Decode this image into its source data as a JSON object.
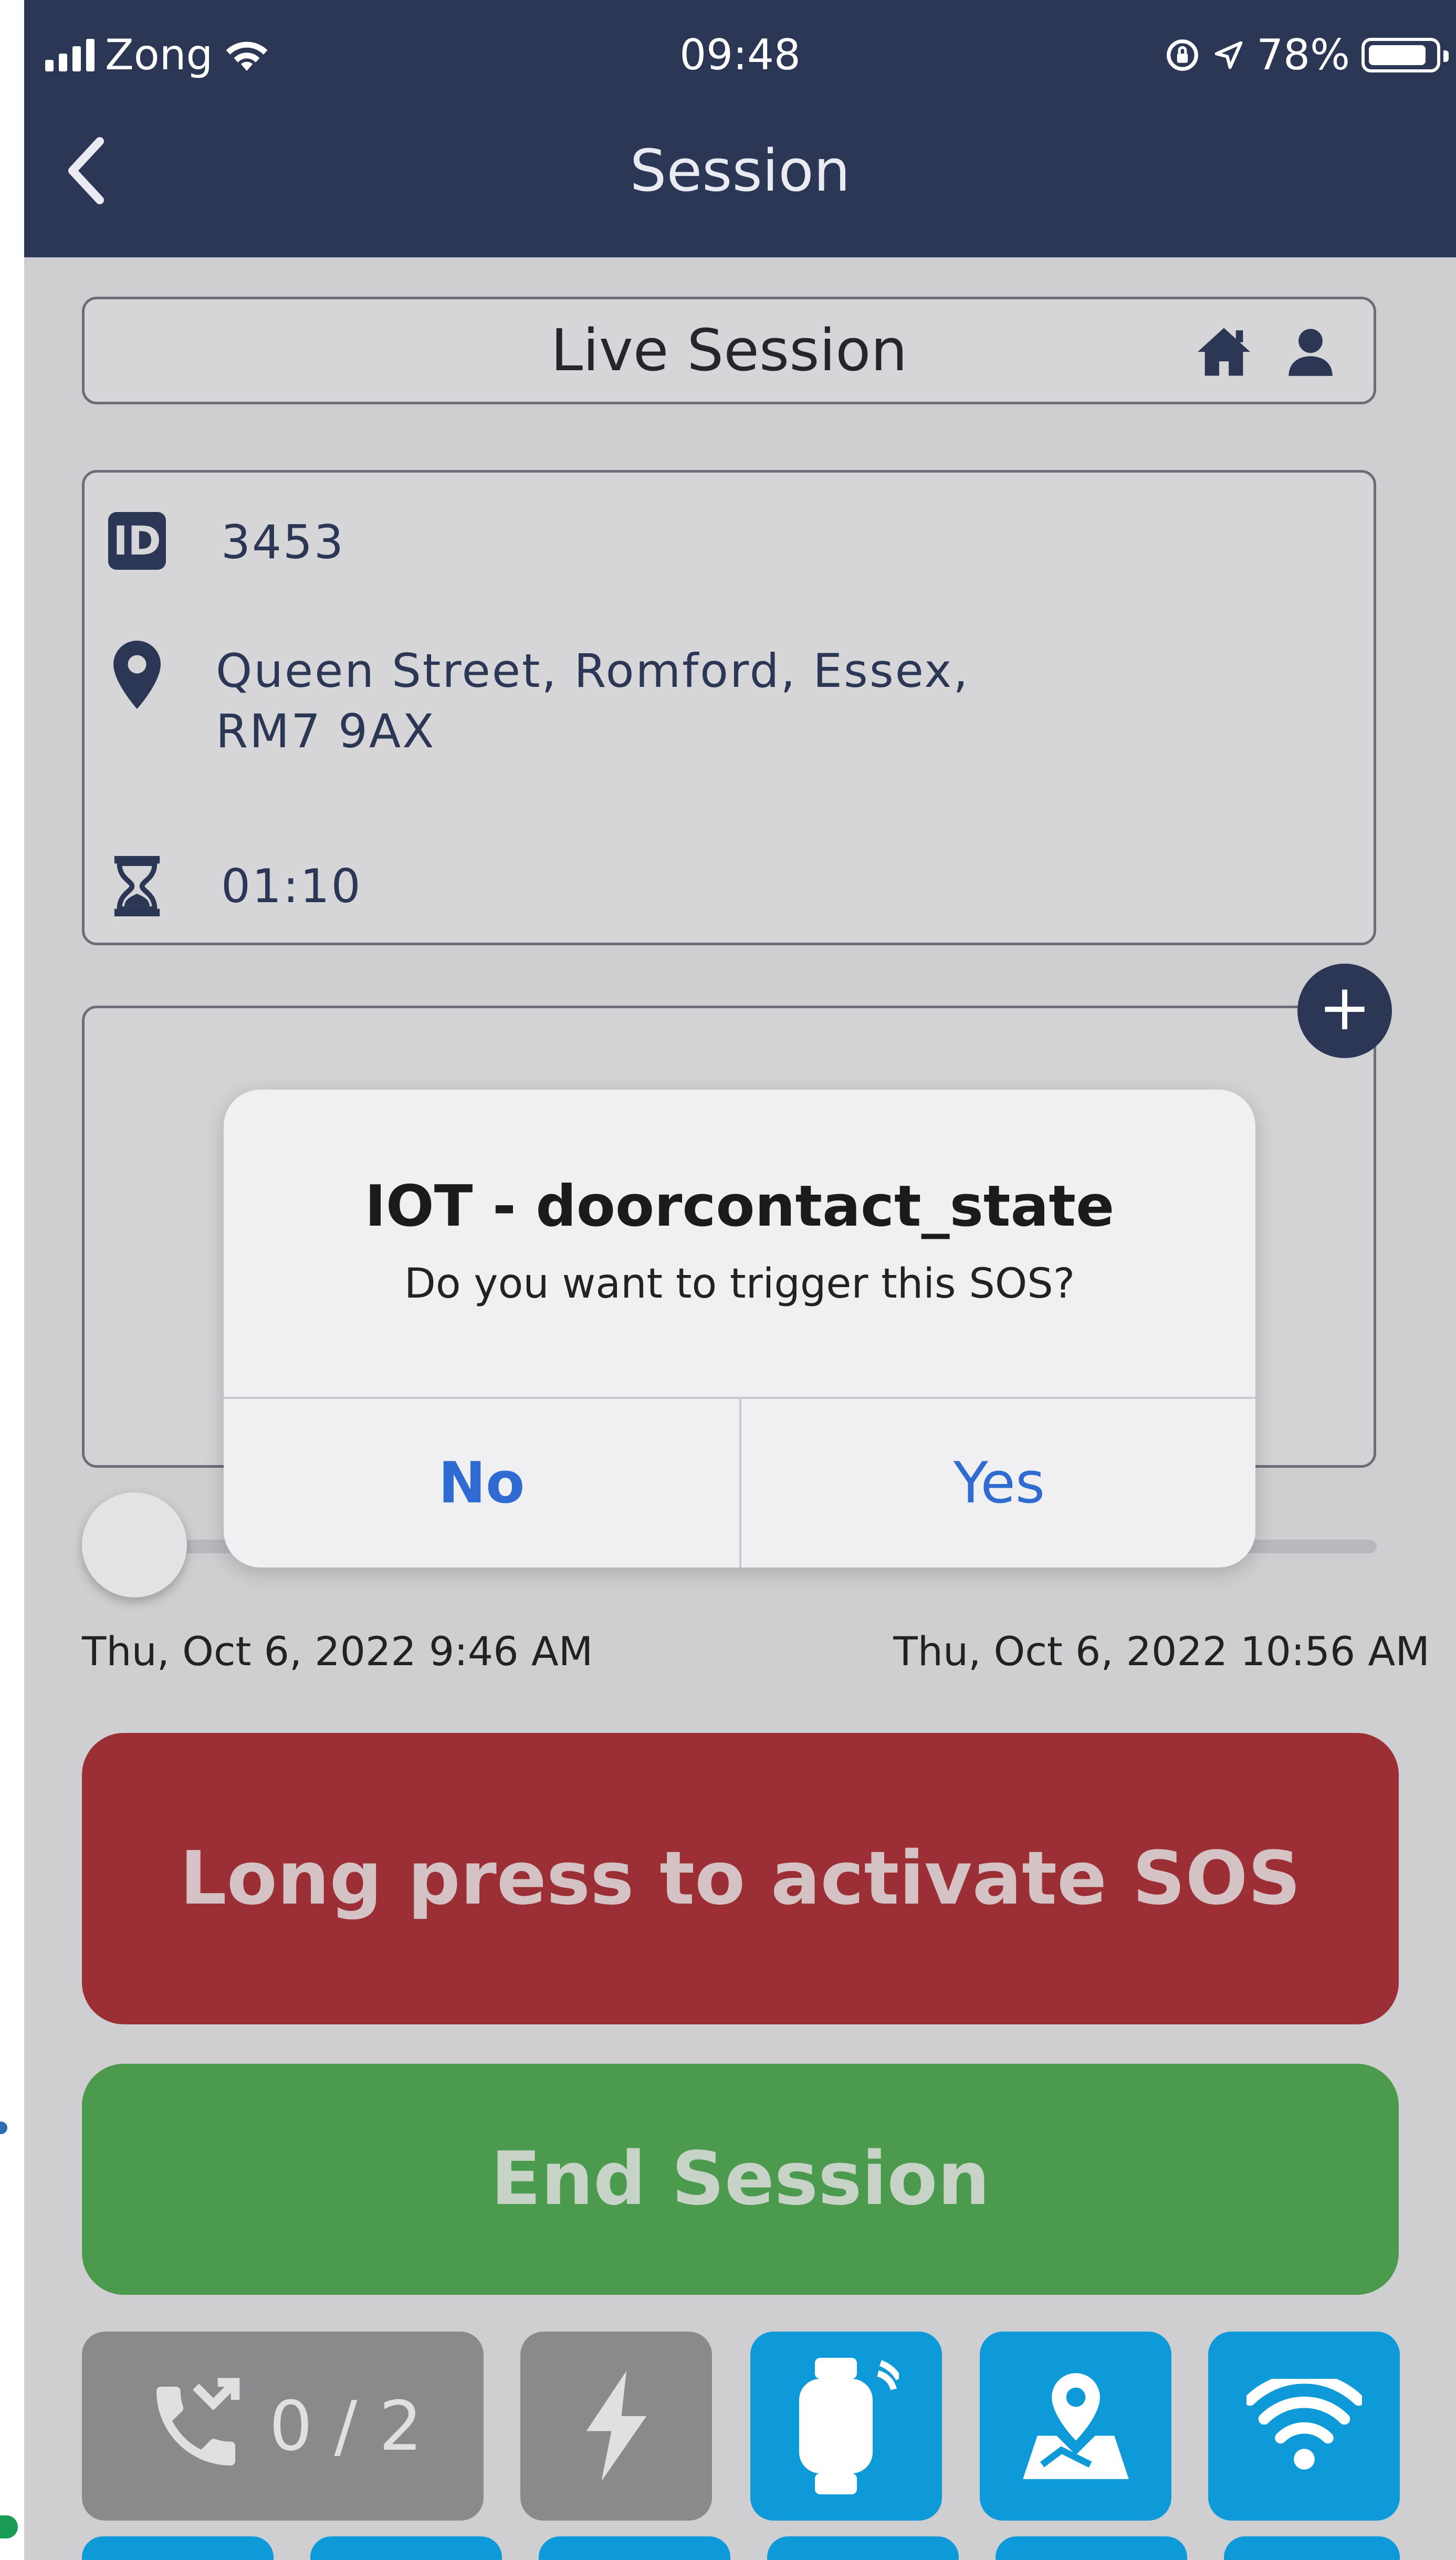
{
  "status_bar": {
    "carrier": "Zong",
    "time": "09:48",
    "battery": "78%"
  },
  "nav": {
    "title": "Session"
  },
  "live_session": {
    "title": "Live Session"
  },
  "session_info": {
    "id": "3453",
    "address_line1": "Queen Street, Romford, Essex,",
    "address_line2": "RM7 9AX",
    "duration": "01:10"
  },
  "timeline": {
    "start": "Thu, Oct 6, 2022 9:46 AM",
    "end": "Thu, Oct 6, 2022 10:56 AM",
    "position": 0.0
  },
  "actions": {
    "sos_label": "Long press to activate SOS",
    "end_label": "End Session",
    "calls_count": "0 / 2"
  },
  "dialog": {
    "title": "IOT - doorcontact_state",
    "message": "Do you want to trigger this SOS?",
    "no_label": "No",
    "yes_label": "Yes"
  },
  "colors": {
    "nav_bg": "#2c3655",
    "sos": "#9b2f35",
    "end": "#4c9a4d",
    "tile_blue": "#0e9ad8",
    "tile_grey": "#8a8a8c",
    "dialog_button": "#2f6bd1"
  },
  "icons": [
    "back-chevron-icon",
    "home-icon",
    "person-icon",
    "id-icon",
    "location-pin-icon",
    "hourglass-icon",
    "plus-icon",
    "call-missed-icon",
    "flash-icon",
    "smartwatch-icon",
    "map-icon",
    "wifi-icon"
  ]
}
